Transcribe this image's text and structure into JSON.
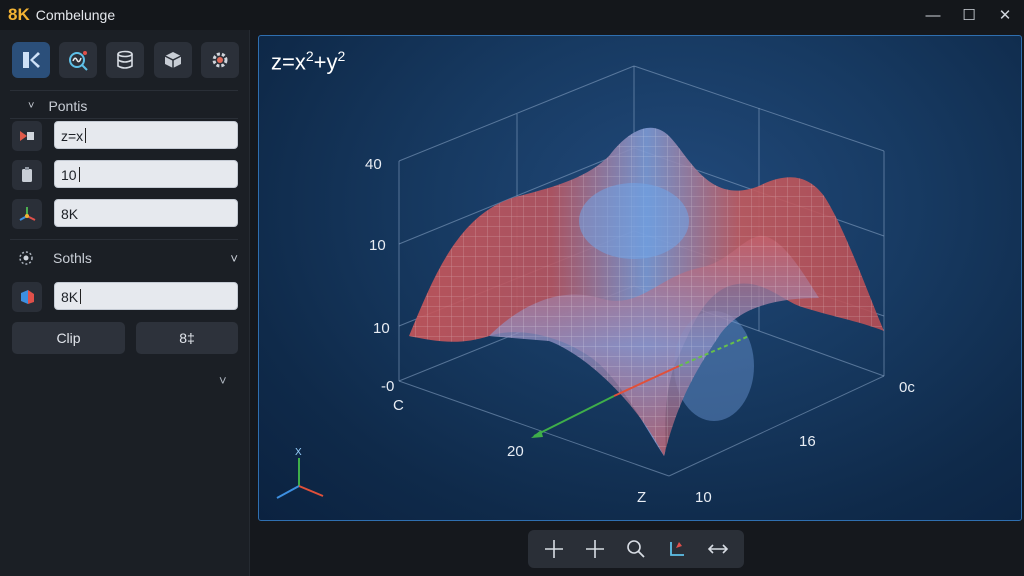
{
  "window": {
    "brand": "8K",
    "title": "Combelunge",
    "minimize": "—",
    "maximize": "☐",
    "close": "✕"
  },
  "sidebar": {
    "tools": [
      "grid-icon",
      "search-plot-icon",
      "database-icon",
      "cube-icon",
      "gear-icon"
    ],
    "section1": {
      "label": "Pontis",
      "chevron": "˅"
    },
    "fields": [
      {
        "icon": "camera-icon",
        "value": "z=x"
      },
      {
        "icon": "clipboard-icon",
        "value": "10"
      },
      {
        "icon": "axes-icon",
        "value": "8K"
      }
    ],
    "section2": {
      "label": "Sothls",
      "chevron": "˅"
    },
    "field4": {
      "icon": "color-cube-icon",
      "value": "8K"
    },
    "clip_label": "Clip",
    "config_label": "8‡",
    "bottom_chevron": "˅"
  },
  "viewport": {
    "equation_base": "z=x",
    "exp1": "2",
    "plus_y": "+y",
    "exp2": "2",
    "z_ticks": [
      "40",
      "10",
      "10",
      "-0"
    ],
    "axis_labels": {
      "left": "C",
      "front": "20",
      "bottom": "Z",
      "bottom_right": "10",
      "right_mid": "16",
      "right": "0c"
    },
    "orient_labels": {
      "top": "X"
    }
  },
  "bottombar": {
    "tools": [
      "crosshair-icon",
      "add-icon",
      "zoom-icon",
      "axis-toggle-icon",
      "pan-horizontal-icon"
    ]
  }
}
